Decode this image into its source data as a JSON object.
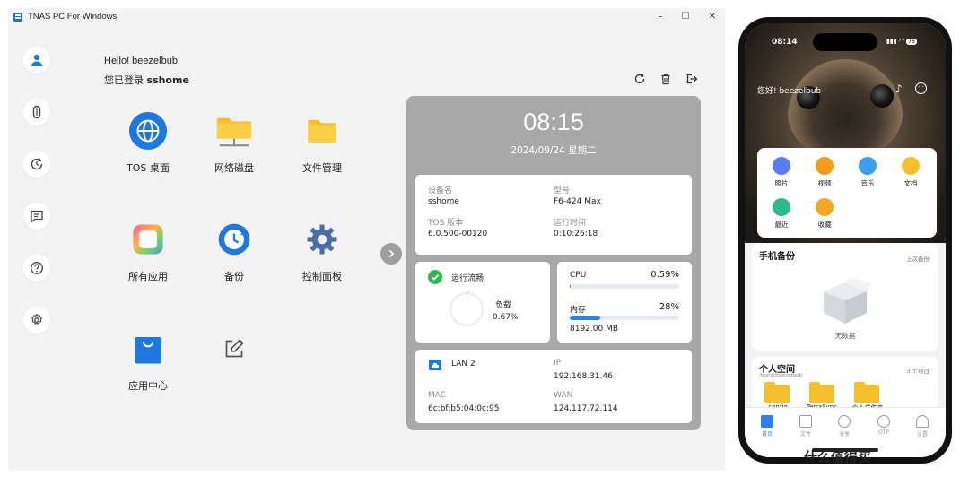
{
  "window": {
    "title": "TNAS PC For Windows"
  },
  "user": {
    "greeting": "Hello! beezelbub",
    "login_prefix": "您已登录",
    "server": "sshome"
  },
  "apps": [
    {
      "label": "TOS 桌面"
    },
    {
      "label": "网络磁盘"
    },
    {
      "label": "文件管理"
    },
    {
      "label": "所有应用"
    },
    {
      "label": "备份"
    },
    {
      "label": "控制面板"
    },
    {
      "label": "应用中心"
    }
  ],
  "dashboard": {
    "time": "08:15",
    "date": "2024/09/24 星期二",
    "device": {
      "name_label": "设备名",
      "name": "sshome",
      "model_label": "型号",
      "model": "F6-424 Max",
      "tos_label": "TOS 版本",
      "tos": "6.0.500-00120",
      "uptime_label": "运行时间",
      "uptime": "0:10:26:18"
    },
    "status": {
      "label": "运行流畅",
      "load_label": "负载",
      "load": "0.67%",
      "load_pct": 0.67
    },
    "resources": {
      "cpu_label": "CPU",
      "cpu": "0.59%",
      "cpu_pct": 0.59,
      "mem_label": "内存",
      "mem": "28%",
      "mem_pct": 28,
      "mem_total": "8192.00 MB"
    },
    "network": {
      "lan": "LAN 2",
      "ip_label": "IP",
      "ip": "192.168.31.46",
      "mac_label": "MAC",
      "mac": "6c:bf:b5:04:0c:95",
      "wan_label": "WAN",
      "wan": "124.117.72.114"
    }
  },
  "phone": {
    "time": "08:14",
    "battery": "76",
    "greeting": "您好!  beezelbub",
    "quick": [
      "照片",
      "视频",
      "音乐",
      "文档",
      "最近",
      "收藏"
    ],
    "backup": {
      "title": "手机备份",
      "last": "上次备份",
      "empty": "无数据"
    },
    "space": {
      "title": "个人空间",
      "path": "/home/beezelbub",
      "count": "3 个项目"
    },
    "folders": [
      ".config",
      "TerraSync",
      "个人文件夹"
    ],
    "tabs": [
      "首页",
      "文件",
      "分享",
      "OTP",
      "设置"
    ]
  },
  "watermark": "什么值得买",
  "colors": {
    "accent": "#2f80ed",
    "panel": "#a8a8a8",
    "ok": "#2dbb4e",
    "folder": "#f6c02c"
  }
}
